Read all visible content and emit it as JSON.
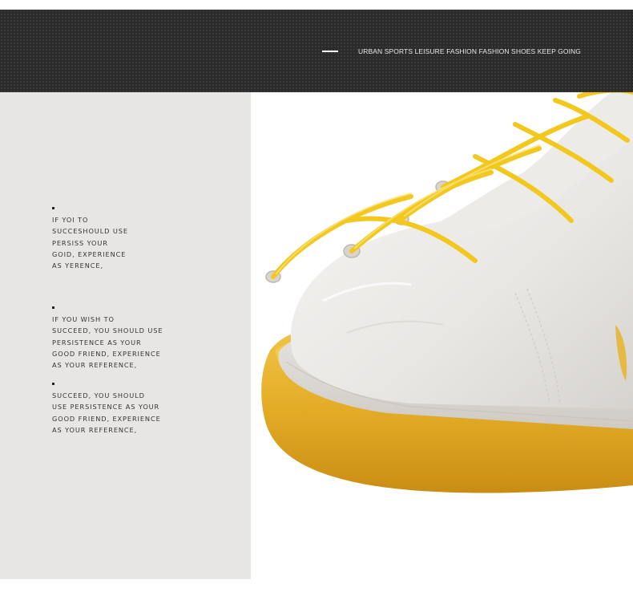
{
  "header": {
    "tagline": "URBAN SPORTS LEISURE FASHION FASHION SHOES KEEP GOING"
  },
  "text_blocks": [
    {
      "lines": [
        "IF YOI TO",
        "SUCCESHOULD USE",
        "PERSISS YOUR",
        "GOID, EXPERIENCE",
        "AS YERENCE,"
      ]
    },
    {
      "lines": [
        "IF YOU WISH TO",
        "SUCCEED, YOU SHOULD USE",
        "PERSISTENCE AS YOUR",
        "GOOD FRIEND, EXPERIENCE",
        "AS YOUR REFERENCE,"
      ]
    },
    {
      "lines": [
        "SUCCEED, YOU SHOULD",
        "USE PERSISTENCE AS YOUR",
        "GOOD FRIEND, EXPERIENCE",
        "AS YOUR REFERENCE,"
      ]
    }
  ],
  "colors": {
    "header_band": "#2b2b2b",
    "left_panel": "#e8e6e4",
    "sole_yellow": "#e8b52c",
    "lace_yellow": "#f2c81e",
    "upper_white": "#efeeec"
  },
  "photo": {
    "subject": "shoe-photo"
  }
}
